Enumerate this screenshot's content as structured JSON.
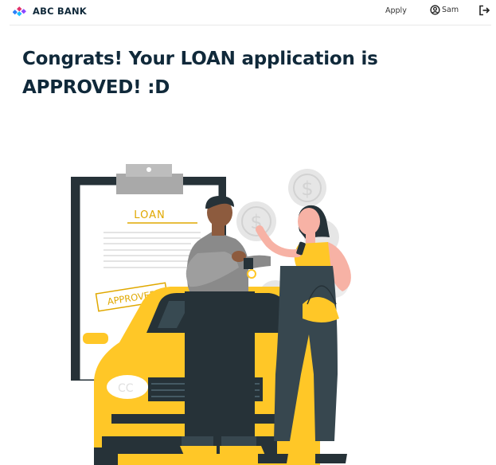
{
  "navbar": {
    "brand_name": "ABC BANK",
    "apply_label": "Apply",
    "user_name": "Sam",
    "icons": {
      "logo": "brand-logo-icon",
      "user": "user-circle-icon",
      "logout": "logout-icon"
    }
  },
  "main": {
    "headline": "Congrats! Your LOAN application is APPROVED! :D"
  },
  "illustration": {
    "clipboard_label": "LOAN",
    "stamp_label": "APPROVED",
    "coin_symbol": "$"
  },
  "colors": {
    "text_dark": "#10293a",
    "accent_yellow": "#ffc727",
    "dark_gray": "#263238"
  }
}
